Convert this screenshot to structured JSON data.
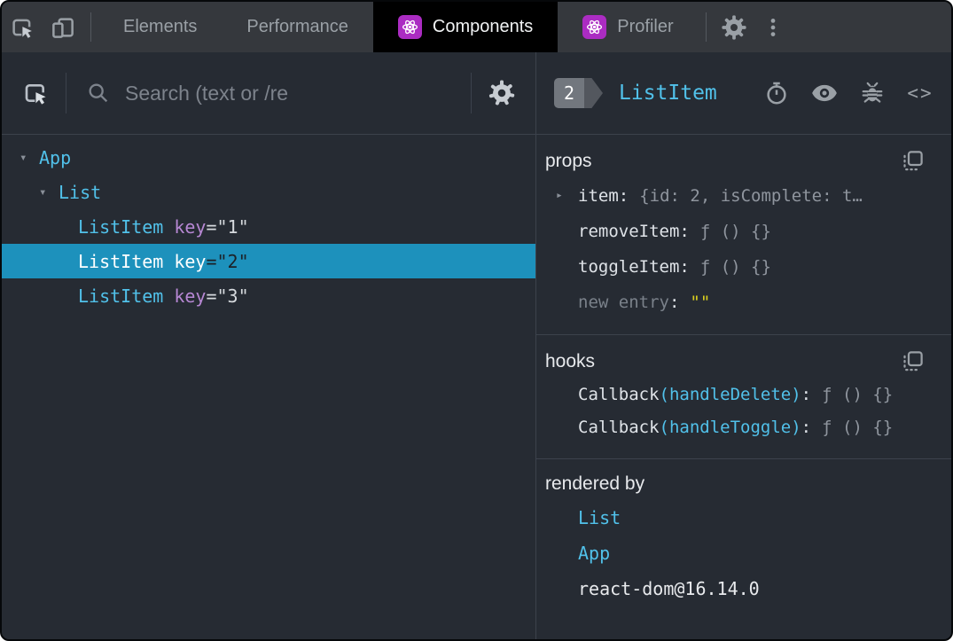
{
  "topbar": {
    "tabs": [
      {
        "label": "Elements"
      },
      {
        "label": "Performance"
      },
      {
        "label": "Components"
      },
      {
        "label": "Profiler"
      }
    ]
  },
  "left": {
    "toolbar": {
      "search_placeholder": "Search (text or /re"
    },
    "tree": {
      "rows": [
        {
          "name": "App"
        },
        {
          "name": "List"
        },
        {
          "name": "ListItem",
          "key_name": "key",
          "key_value": "=\"1\""
        },
        {
          "name": "ListItem",
          "key_name": "key",
          "key_value": "=\"2\""
        },
        {
          "name": "ListItem",
          "key_name": "key",
          "key_value": "=\"3\""
        }
      ]
    }
  },
  "right": {
    "header": {
      "badge_count": "2",
      "component_name": "ListItem"
    },
    "props": {
      "title": "props",
      "rows": [
        {
          "key": "item",
          "colon": ":",
          "value": "{id: 2, isComplete: t…"
        },
        {
          "key": "removeItem",
          "colon": ":",
          "value": "ƒ () {}"
        },
        {
          "key": "toggleItem",
          "colon": ":",
          "value": "ƒ () {}"
        },
        {
          "key": "new entry",
          "colon": ":",
          "value": "\"\""
        }
      ]
    },
    "hooks": {
      "title": "hooks",
      "rows": [
        {
          "fn": "Callback",
          "arg": "(handleDelete)",
          "colon": ":",
          "value": "ƒ () {}"
        },
        {
          "fn": "Callback",
          "arg": "(handleToggle)",
          "colon": ":",
          "value": "ƒ () {}"
        }
      ]
    },
    "rendered_by": {
      "title": "rendered by",
      "links": [
        "List",
        "App"
      ],
      "version": "react-dom@16.14.0"
    }
  },
  "icons": {
    "expanded": "▾",
    "collapsed": "▸",
    "code": "<>"
  },
  "colors": {
    "selection": "#1d91bc",
    "component_name": "#51c1ea",
    "key_attr": "#b687d3",
    "string_value": "#dcd11e",
    "react_purple": "#ab2cc2",
    "panel_bg": "#262b33",
    "topbar_bg": "#35383d"
  }
}
